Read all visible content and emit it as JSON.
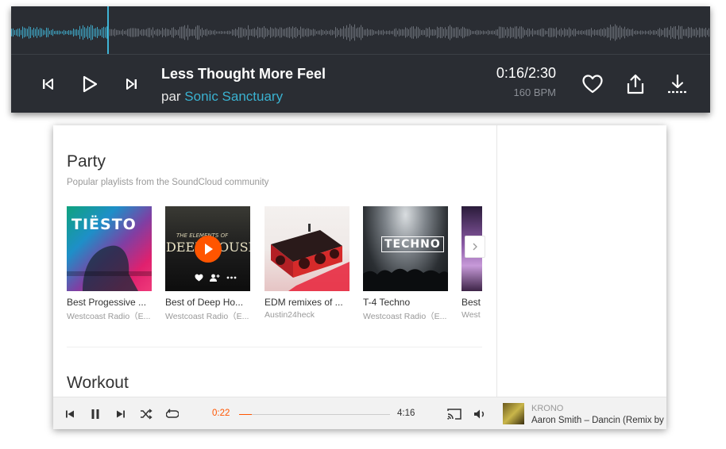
{
  "top_player": {
    "waveform_progress": 0.138,
    "title": "Less Thought More Feel",
    "by_prefix": "par ",
    "artist": "Sonic Sanctuary",
    "time": "0:16/2:30",
    "bpm": "160 BPM",
    "icons": [
      "skip-back-icon",
      "play-icon",
      "skip-forward-icon",
      "heart-icon",
      "share-icon",
      "download-icon"
    ]
  },
  "section_party": {
    "title": "Party",
    "subtitle": "Popular playlists from the SoundCloud community",
    "cards": [
      {
        "title": "Best Progessive ...",
        "user": "Westcoast Radio（E...",
        "cover_text": "TIËSTO"
      },
      {
        "title": "Best of Deep Ho...",
        "user": "Westcoast Radio（E...",
        "cover_text_top": "THE ELEMENTS OF",
        "cover_text": "DEEP HOUSE"
      },
      {
        "title": "EDM remixes of ...",
        "user": "Austin24heck"
      },
      {
        "title": "T-4 Techno",
        "user": "Westcoast Radio（E...",
        "cover_text": "TECHNO"
      },
      {
        "title": "Best",
        "user": "West"
      }
    ]
  },
  "section_workout": {
    "title": "Workout"
  },
  "bottom_bar": {
    "elapsed": "0:22",
    "duration": "4:16",
    "progress": 0.086,
    "now_playing_user": "KRONO",
    "now_playing_title": "Aaron Smith – Dancin (Remix by"
  },
  "colors": {
    "accent": "#ff5500",
    "link_blue": "#3ab1d0",
    "dark_bg": "#2a2d33"
  }
}
